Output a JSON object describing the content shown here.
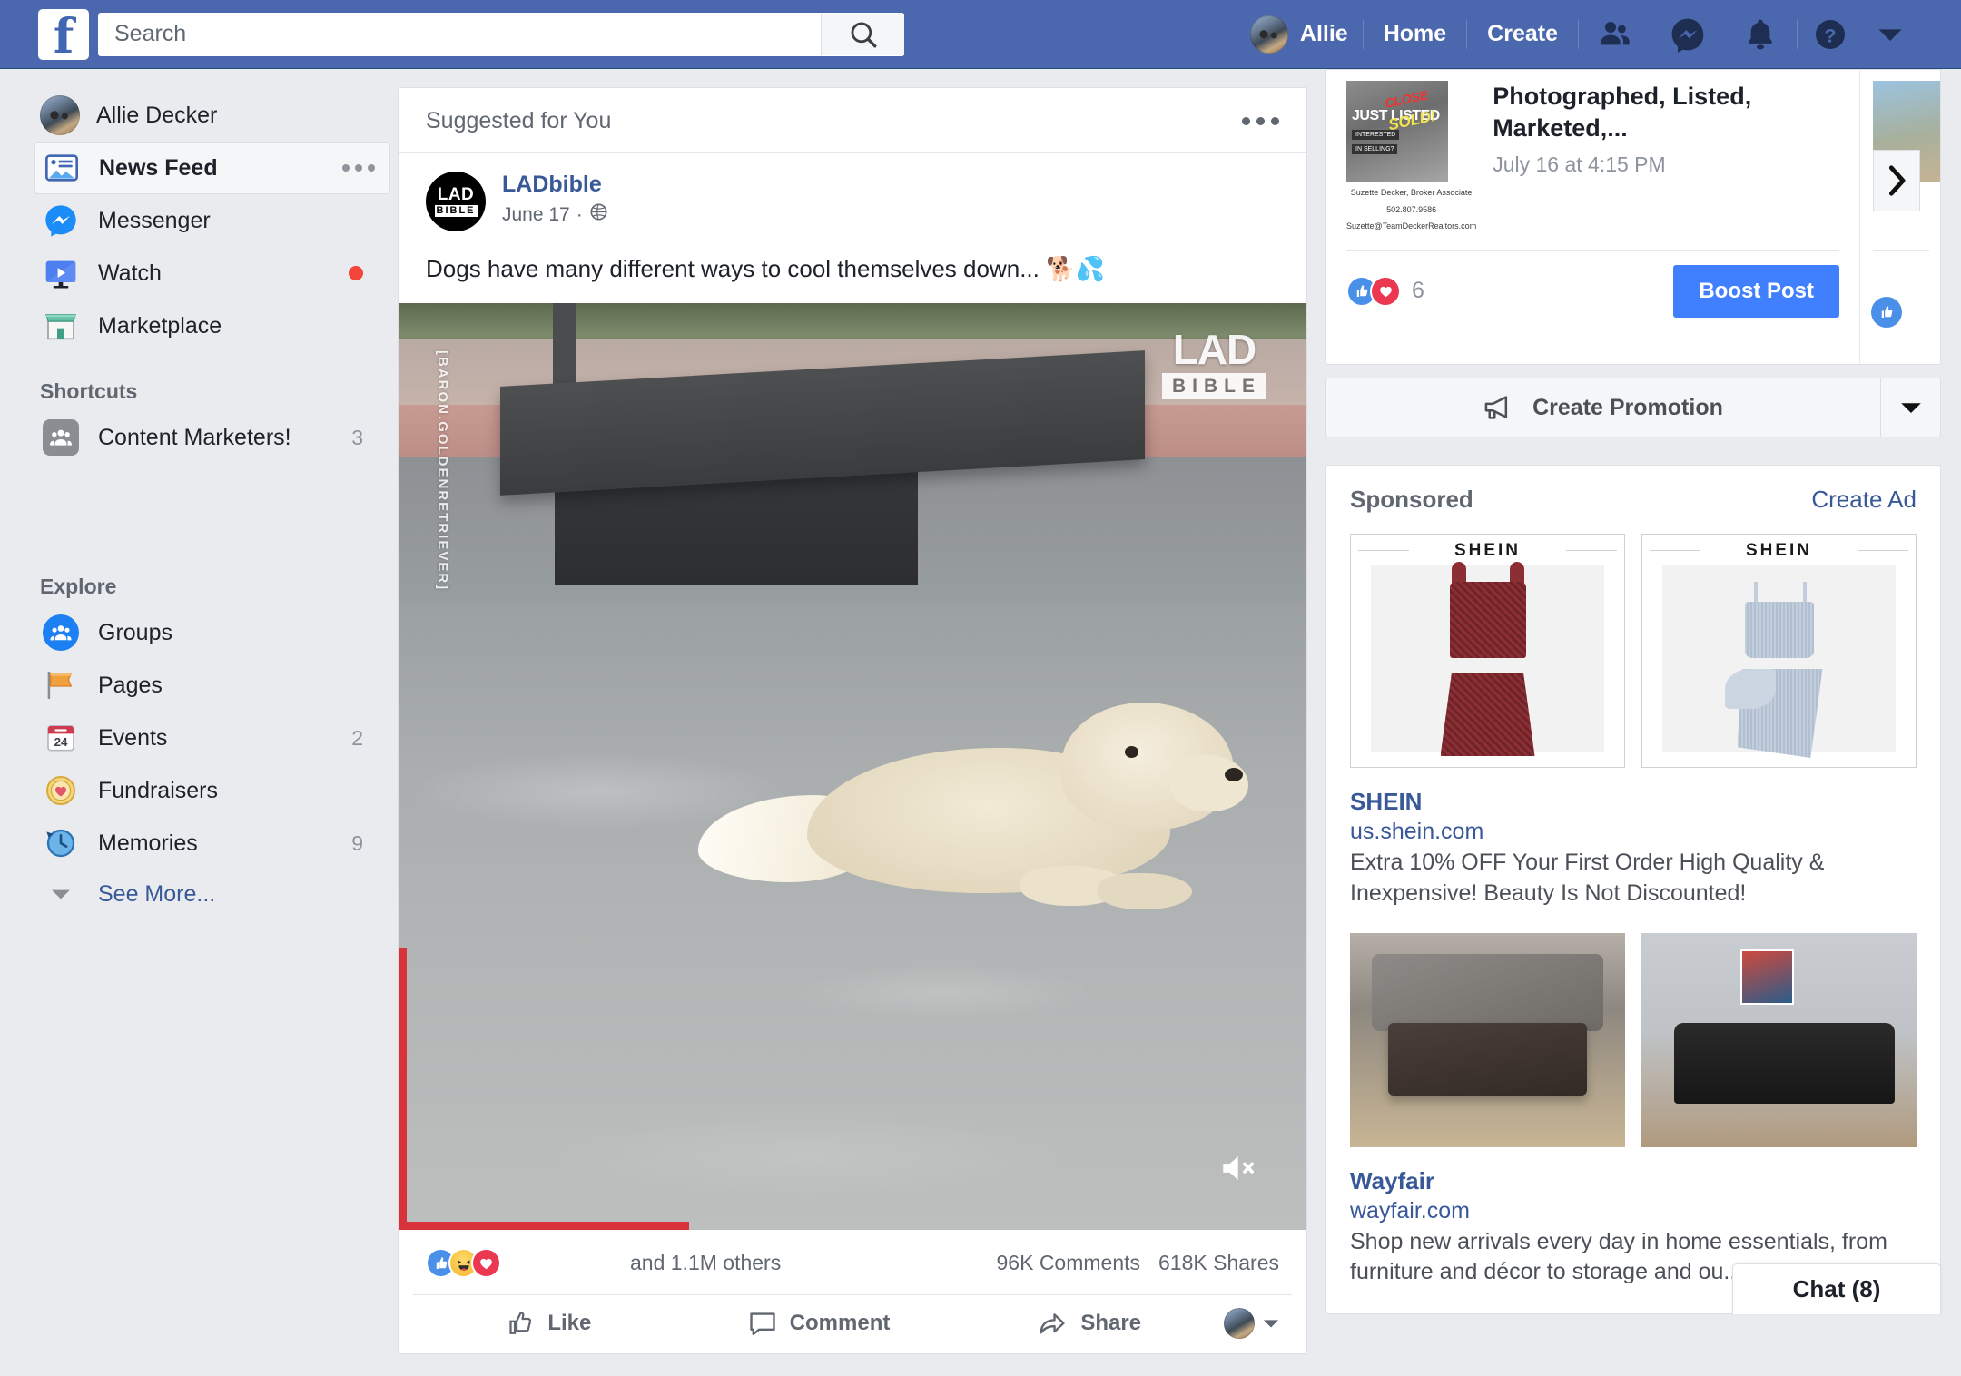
{
  "topnav": {
    "logo_letter": "f",
    "search_placeholder": "Search",
    "search_value": "",
    "search_icon": "search-icon",
    "profile_name": "Allie",
    "home_label": "Home",
    "create_label": "Create",
    "icons": [
      "friend-requests-icon",
      "messenger-icon",
      "notifications-icon",
      "help-icon",
      "account-menu-caret-icon"
    ],
    "bg_color": "#4b67ad"
  },
  "sidebar": {
    "user": {
      "name": "Allie Decker"
    },
    "main_items": [
      {
        "label": "News Feed",
        "icon": "news-feed-icon",
        "active": true,
        "badge": "",
        "has_dots": true
      },
      {
        "label": "Messenger",
        "icon": "messenger-icon",
        "active": false,
        "badge": ""
      },
      {
        "label": "Watch",
        "icon": "watch-icon",
        "active": false,
        "badge": "",
        "has_red_dot": true
      },
      {
        "label": "Marketplace",
        "icon": "marketplace-icon",
        "active": false,
        "badge": ""
      }
    ],
    "shortcuts_header": "Shortcuts",
    "shortcuts": [
      {
        "label": "Content Marketers!",
        "icon": "group-icon",
        "badge": "3"
      }
    ],
    "explore_header": "Explore",
    "explore": [
      {
        "label": "Groups",
        "icon": "groups-icon",
        "badge": ""
      },
      {
        "label": "Pages",
        "icon": "pages-flag-icon",
        "badge": ""
      },
      {
        "label": "Events",
        "icon": "events-calendar-icon",
        "badge": "2"
      },
      {
        "label": "Fundraisers",
        "icon": "fundraisers-coin-icon",
        "badge": ""
      },
      {
        "label": "Memories",
        "icon": "memories-clock-icon",
        "badge": "9"
      }
    ],
    "see_more_label": "See More..."
  },
  "feed": {
    "suggested_label": "Suggested for You",
    "post": {
      "page_name": "LADbible",
      "logo_line1": "LAD",
      "logo_line2": "BIBLE",
      "date": "June 17",
      "privacy_icon": "globe-icon",
      "text": "Dogs have many different ways to cool themselves down... 🐕💦",
      "video": {
        "watermark_main_line1": "LAD",
        "watermark_main_line2": "BIBLE",
        "watermark_vertical": "[BARON.GOLDENRETRIEVER]",
        "mute_icon": "speaker-muted-icon"
      },
      "reactions": [
        "like-reaction",
        "haha-reaction",
        "love-reaction"
      ],
      "others_text": "and 1.1M others",
      "comments_text": "96K Comments",
      "shares_text": "618K Shares",
      "actions": [
        {
          "label": "Like",
          "icon": "thumbs-up-icon"
        },
        {
          "label": "Comment",
          "icon": "comment-bubble-icon"
        },
        {
          "label": "Share",
          "icon": "share-arrow-icon"
        }
      ]
    }
  },
  "right": {
    "promo": {
      "title": "Photographed, Listed, Marketed,...",
      "date": "July 16 at 4:15 PM",
      "thumb": {
        "just_listed": "JUST LISTED",
        "sold": "SOLD!",
        "close": "CLOSE",
        "interested": "INTERESTED",
        "in_selling": "IN SELLING?",
        "agent": "Suzette Decker, Broker Associate",
        "phone": "502.807.9586",
        "email": "Suzette@TeamDeckerRealtors.com"
      },
      "reaction_count": "6",
      "reactions": [
        "like-reaction",
        "love-reaction"
      ],
      "boost_label": "Boost Post",
      "next_icon": "chevron-right-icon"
    },
    "create_promotion": {
      "label": "Create Promotion",
      "icon": "megaphone-icon",
      "caret_icon": "caret-down-icon"
    },
    "sponsored": {
      "header": "Sponsored",
      "create_ad_label": "Create Ad",
      "ads": [
        {
          "brand": "SHEIN",
          "url": "us.shein.com",
          "description": "Extra 10% OFF Your First Order High Quality & Inexpensive! Beauty Is Not Discounted!",
          "image_labels": [
            "SHEIN",
            "SHEIN"
          ]
        },
        {
          "brand": "Wayfair",
          "url": "wayfair.com",
          "description": "Shop new arrivals every day in home essentials, from furniture and décor to storage and ou..."
        }
      ]
    }
  },
  "chat": {
    "label": "Chat (8)"
  }
}
